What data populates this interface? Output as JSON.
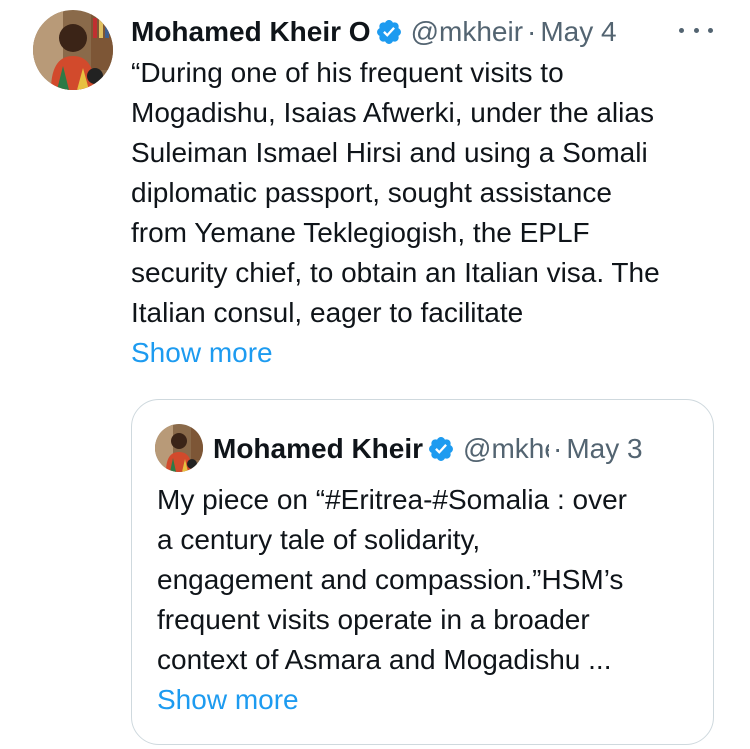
{
  "tweet": {
    "author_name": "Mohamed Kheir O",
    "author_handle": "@mkheir",
    "separator": "·",
    "date": "May 4",
    "text_lines": [
      "“During one of his frequent visits to",
      "Mogadishu, Isaias Afwerki, under the alias",
      "Suleiman Ismael Hirsi and using a Somali",
      "diplomatic passport, sought assistance",
      "from Yemane Teklegiogish, the EPLF",
      "security chief, to obtain an Italian visa. The",
      "Italian consul, eager to facilitate"
    ],
    "show_more": "Show more"
  },
  "quote": {
    "author_name": "Mohamed Kheir",
    "author_handle": "@mkheir",
    "separator": "·",
    "date": "May 3",
    "text_lines": [
      "My piece on “#Eritrea-#Somalia : over",
      "a century tale of solidarity,",
      "engagement and compassion.”HSM’s",
      "frequent visits operate in a broader",
      "context of Asmara and Mogadishu ..."
    ],
    "show_more": "Show more"
  },
  "colors": {
    "accent": "#1d9bf0",
    "text_primary": "#0f1419",
    "text_secondary": "#536471",
    "border": "#cfd9de"
  },
  "icons": {
    "verified": "verified-badge-icon",
    "more": "more-options-icon"
  }
}
